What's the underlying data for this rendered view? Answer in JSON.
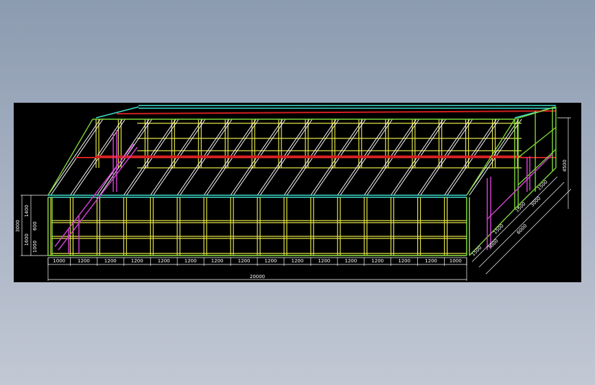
{
  "colors": {
    "background": "#000000",
    "frame_yellow": "#e8e84a",
    "frame_green": "#7fd93a",
    "frame_cyan": "#3fe0d0",
    "frame_white": "#ffffff",
    "frame_red": "#d42020",
    "frame_magenta": "#d040d0",
    "dimension_line": "#ffffff"
  },
  "dimensions": {
    "bottom_segments": [
      "1000",
      "1200",
      "1200",
      "1200",
      "1200",
      "1200",
      "1200",
      "1200",
      "1200",
      "1200",
      "1200",
      "1200",
      "1200",
      "1200",
      "1200",
      "1000"
    ],
    "bottom_total": "20000",
    "left_segments": [
      "1400",
      "600",
      "1600",
      "1000"
    ],
    "left_total": "3000",
    "right_height": "4500",
    "side_small": [
      "1500",
      "1500",
      "1500",
      "1500"
    ],
    "side_mid": [
      "3000",
      "3000"
    ],
    "side_total": "6000"
  }
}
